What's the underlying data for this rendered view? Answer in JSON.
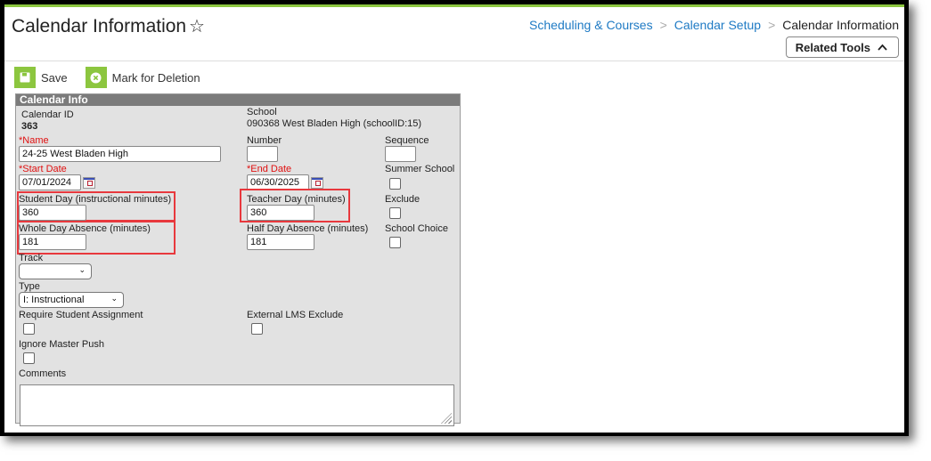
{
  "header": {
    "title": "Calendar Information",
    "star_icon": "star-outline-icon",
    "breadcrumb": [
      {
        "label": "Scheduling & Courses",
        "link": true
      },
      {
        "label": "Calendar Setup",
        "link": true
      },
      {
        "label": "Calendar Information",
        "link": false
      }
    ],
    "breadcrumb_separator": ">",
    "related_tools_label": "Related Tools",
    "related_tools_icon": "chevron-up-icon"
  },
  "toolbar": {
    "save_label": "Save",
    "save_icon": "floppy-disk-icon",
    "delete_label": "Mark for Deletion",
    "delete_icon": "circle-x-icon"
  },
  "panel": {
    "title": "Calendar Info",
    "calendar_id_label": "Calendar ID",
    "calendar_id_value": "363",
    "school_label": "School",
    "school_value": "090368 West Bladen High (schoolID:15)",
    "name_label": "Name",
    "name_value": "24-25 West Bladen High",
    "number_label": "Number",
    "number_value": "",
    "sequence_label": "Sequence",
    "sequence_value": "",
    "start_date_label": "Start Date",
    "start_date_value": "07/01/2024",
    "end_date_label": "End Date",
    "end_date_value": "06/30/2025",
    "summer_school_label": "Summer School",
    "summer_school_checked": false,
    "student_day_label": "Student Day (instructional minutes)",
    "student_day_value": "360",
    "teacher_day_label": "Teacher Day (minutes)",
    "teacher_day_value": "360",
    "exclude_label": "Exclude",
    "exclude_checked": false,
    "whole_day_absence_label": "Whole Day Absence (minutes)",
    "whole_day_absence_value": "181",
    "half_day_absence_label": "Half Day Absence (minutes)",
    "half_day_absence_value": "181",
    "school_choice_label": "School Choice",
    "school_choice_checked": false,
    "track_label": "Track",
    "track_value": "",
    "type_label": "Type",
    "type_value": "I: Instructional",
    "require_student_assignment_label": "Require Student Assignment",
    "require_student_assignment_checked": false,
    "external_lms_exclude_label": "External LMS Exclude",
    "external_lms_exclude_checked": false,
    "ignore_master_push_label": "Ignore Master Push",
    "ignore_master_push_checked": false,
    "comments_label": "Comments",
    "comments_value": "",
    "required_marker": "*"
  },
  "colors": {
    "accent_green": "#8cc63f",
    "link_blue": "#1e7ac4",
    "required_red": "#e01010",
    "highlight_red": "#e8383d",
    "panel_header": "#7b7b7b",
    "panel_bg": "#e2e2e2"
  }
}
